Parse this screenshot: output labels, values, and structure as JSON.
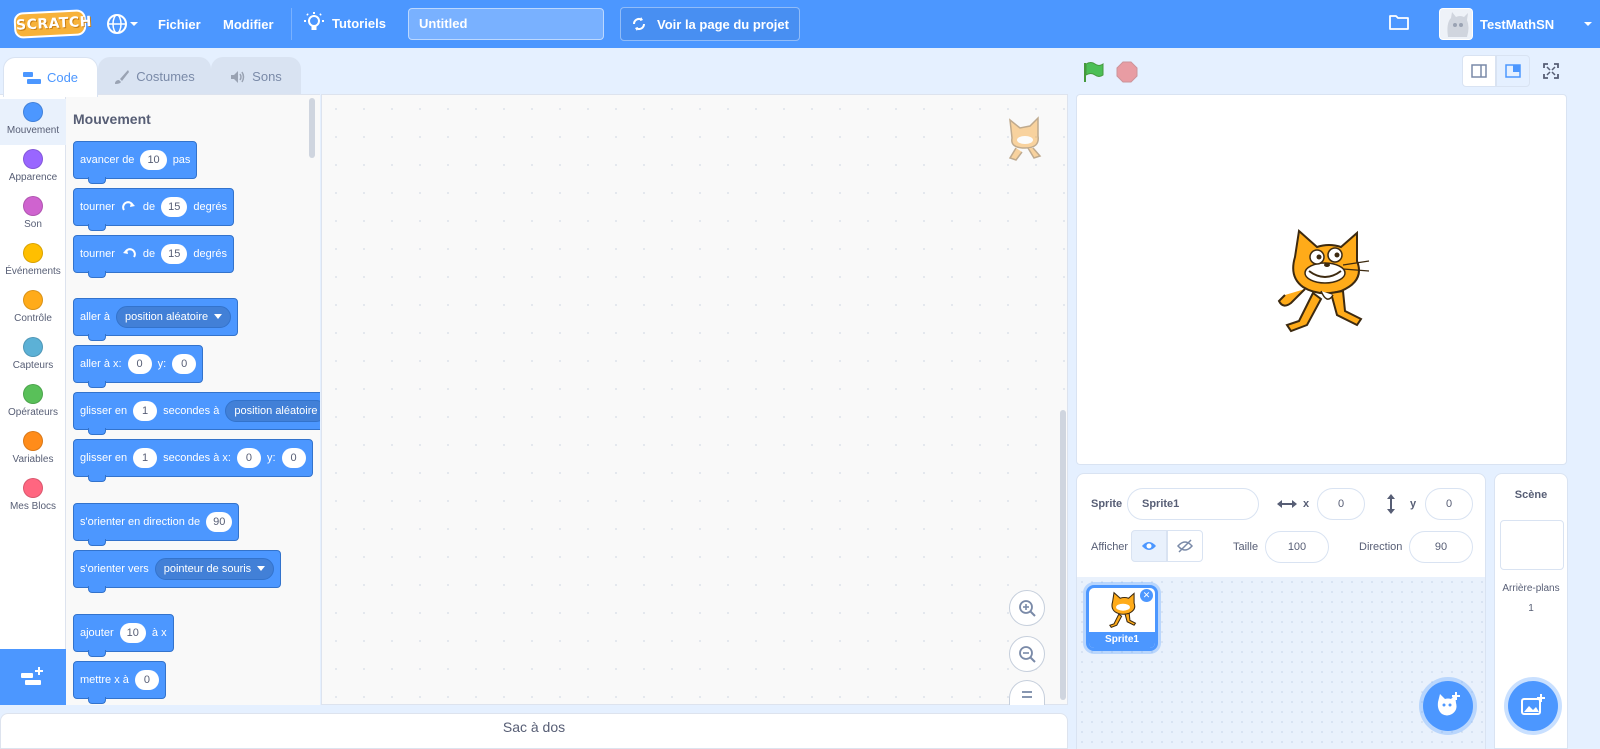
{
  "menubar": {
    "logo": "SCRATCH",
    "file": "Fichier",
    "edit": "Modifier",
    "tutorials": "Tutoriels",
    "project_title": "Untitled",
    "see_project": "Voir la page du projet",
    "username": "TestMathSN"
  },
  "tabs": {
    "code": "Code",
    "costumes": "Costumes",
    "sounds": "Sons"
  },
  "categories": [
    {
      "label": "Mouvement",
      "color": "#4c97ff"
    },
    {
      "label": "Apparence",
      "color": "#9966ff"
    },
    {
      "label": "Son",
      "color": "#cf63cf"
    },
    {
      "label": "Événements",
      "color": "#ffbf00"
    },
    {
      "label": "Contrôle",
      "color": "#ffab19"
    },
    {
      "label": "Capteurs",
      "color": "#5cb1d6"
    },
    {
      "label": "Opérateurs",
      "color": "#59c059"
    },
    {
      "label": "Variables",
      "color": "#ff8c1a"
    },
    {
      "label": "Mes Blocs",
      "color": "#ff6680"
    }
  ],
  "palette": {
    "heading": "Mouvement",
    "move": {
      "a": "avancer de",
      "v": "10",
      "b": "pas"
    },
    "turn_right": {
      "a": "tourner",
      "b": "de",
      "v": "15",
      "c": "degrés"
    },
    "turn_left": {
      "a": "tourner",
      "b": "de",
      "v": "15",
      "c": "degrés"
    },
    "goto": {
      "a": "aller à",
      "dd": "position aléatoire"
    },
    "goto_xy": {
      "a": "aller à x:",
      "x": "0",
      "b": "y:",
      "y": "0"
    },
    "glide": {
      "a": "glisser en",
      "v": "1",
      "b": "secondes à",
      "dd": "position aléatoire"
    },
    "glide_xy": {
      "a": "glisser en",
      "v": "1",
      "b": "secondes à x:",
      "x": "0",
      "c": "y:",
      "y": "0"
    },
    "point_dir": {
      "a": "s'orienter en direction de",
      "v": "90"
    },
    "point_towards": {
      "a": "s'orienter vers",
      "dd": "pointeur de souris"
    },
    "change_x": {
      "a": "ajouter",
      "v": "10",
      "b": "à x"
    },
    "set_x": {
      "a": "mettre x à",
      "v": "0"
    }
  },
  "backpack": "Sac à dos",
  "sprite_info": {
    "sprite_label": "Sprite",
    "sprite_name": "Sprite1",
    "x_label": "x",
    "x_value": "0",
    "y_label": "y",
    "y_value": "0",
    "show_label": "Afficher",
    "size_label": "Taille",
    "size_value": "100",
    "direction_label": "Direction",
    "direction_value": "90"
  },
  "sprites": [
    {
      "name": "Sprite1"
    }
  ],
  "scene": {
    "title": "Scène",
    "backdrops_label": "Arrière-plans",
    "backdrops_count": "1"
  }
}
